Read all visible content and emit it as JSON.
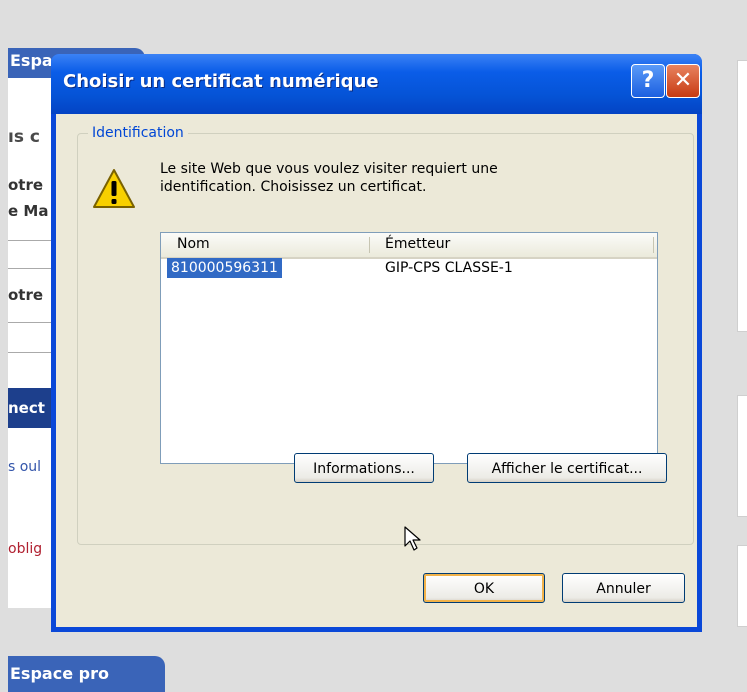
{
  "background": {
    "top_tab": "Espa",
    "heading_fragment": "ıs c",
    "line1": "otre",
    "line2": "e Ma",
    "line3": "otre",
    "blue_band": "nect",
    "link_fragment": "s oul",
    "required_fragment": "oblig",
    "bottom_tab": "Espace pro"
  },
  "dialog": {
    "title": "Choisir un certificat numérique",
    "help_glyph": "?",
    "close_glyph": "✕",
    "group_label": "Identification",
    "warning_icon": "warning-icon",
    "message_line1": "Le site Web que vous voulez visiter requiert une",
    "message_line2": "identification. Choisissez un certificat.",
    "columns": [
      "Nom",
      "Émetteur"
    ],
    "certificates": [
      {
        "name": "810000596311",
        "issuer": "GIP-CPS CLASSE-1",
        "selected": true
      }
    ],
    "info_button": "Informations...",
    "view_cert_button": "Afficher le certificat...",
    "ok_button": "OK",
    "cancel_button": "Annuler"
  },
  "colors": {
    "titlebar": "#0553d6",
    "selection": "#316ac5",
    "group_label": "#0046d5"
  }
}
